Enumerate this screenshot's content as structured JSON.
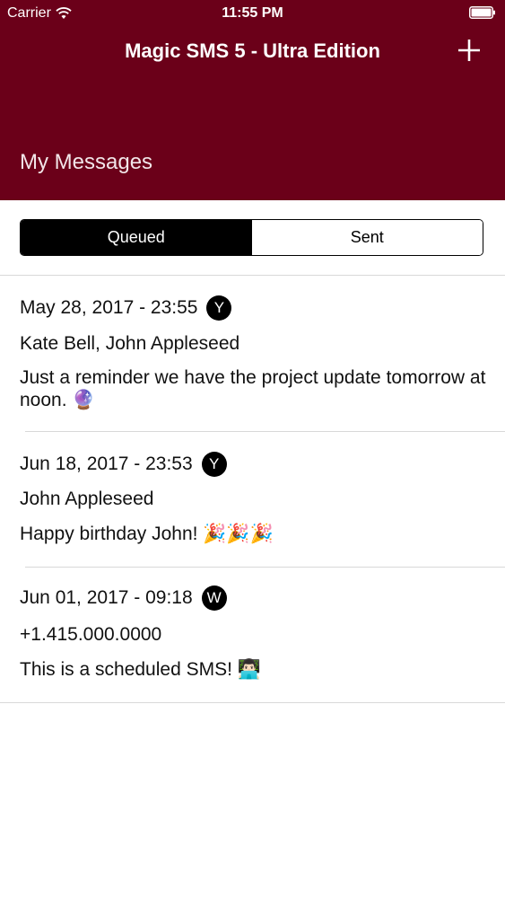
{
  "status_bar": {
    "carrier": "Carrier",
    "time": "11:55 PM",
    "wifi_icon": "wifi-icon",
    "battery_icon": "battery-icon"
  },
  "header": {
    "title": "Magic SMS 5 - Ultra Edition",
    "add_icon": "plus-icon",
    "large_title": "My Messages",
    "background_color": "#6b0019"
  },
  "segments": {
    "queued": "Queued",
    "sent": "Sent",
    "selected": "Queued"
  },
  "messages": [
    {
      "date": "May 28, 2017 - 23:55",
      "badge": "Y",
      "recipients": "Kate Bell, John Appleseed",
      "body": "Just a reminder we have the project update tomorrow at noon. 🔮"
    },
    {
      "date": "Jun 18, 2017 - 23:53",
      "badge": "Y",
      "recipients": "John Appleseed",
      "body": "Happy birthday John! 🎉🎉🎉"
    },
    {
      "date": "Jun 01, 2017 - 09:18",
      "badge": "W",
      "recipients": "+1.415.000.0000",
      "body": "This is a scheduled SMS! 👨🏻‍💻"
    }
  ]
}
